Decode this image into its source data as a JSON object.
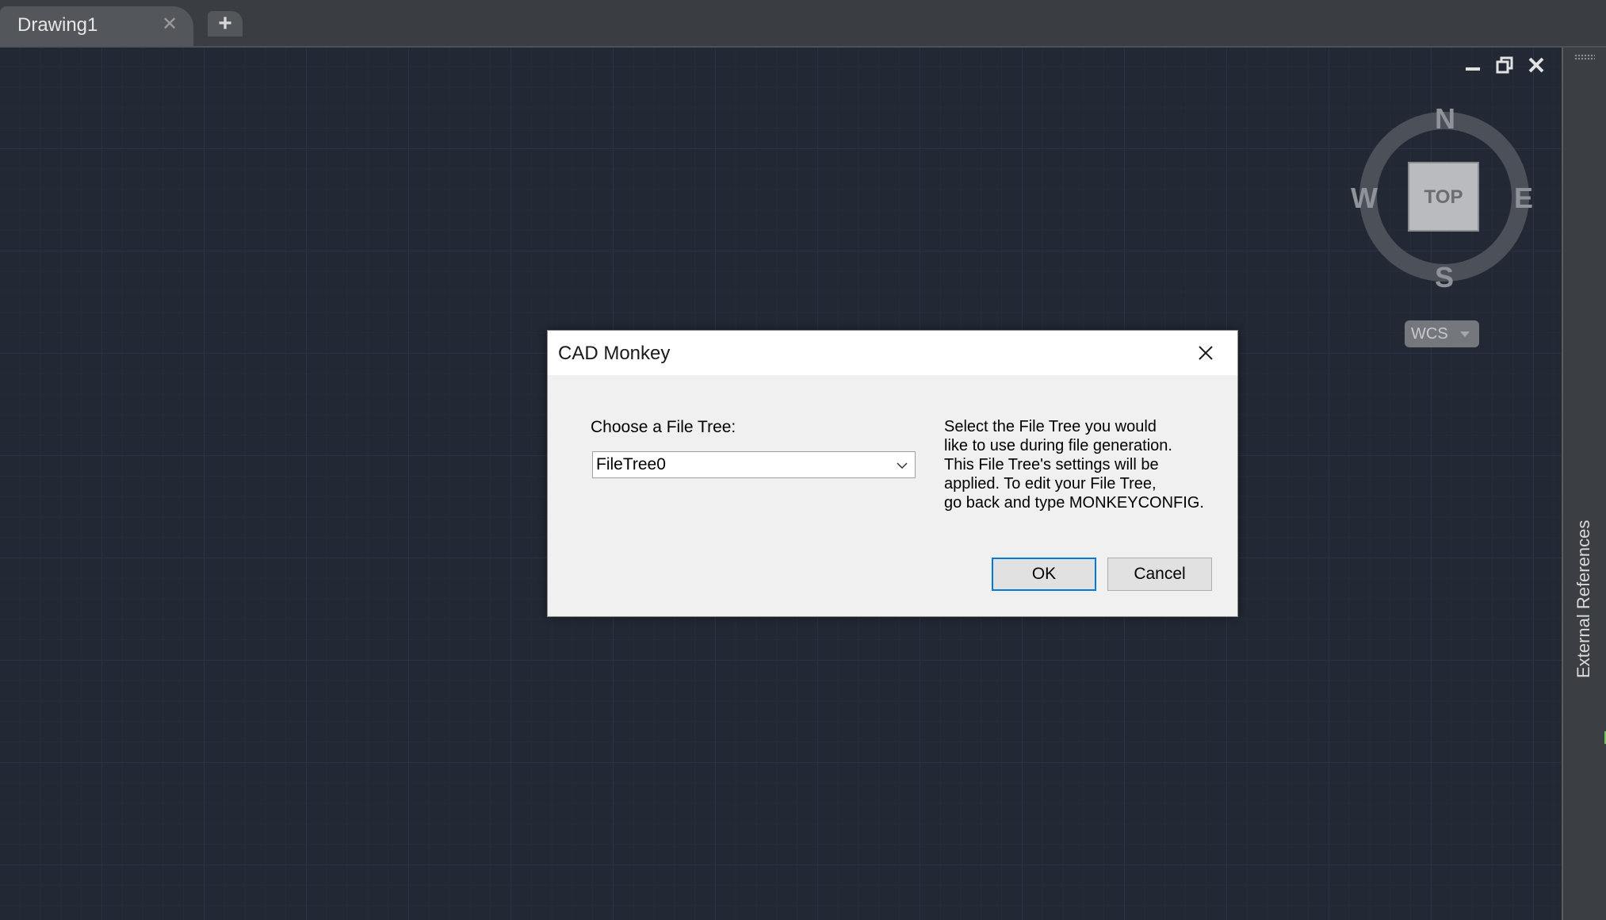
{
  "tabs": {
    "documents": [
      {
        "label": "Drawing1",
        "close_glyph": "✕"
      }
    ],
    "new_tab_glyph": "+"
  },
  "viewport": {
    "controls": [
      {
        "name": "minimize-icon"
      },
      {
        "name": "restore-icon"
      },
      {
        "name": "close-icon"
      }
    ],
    "viewcube": {
      "north": "N",
      "south": "S",
      "east": "E",
      "west": "W",
      "face": "TOP"
    },
    "ucs_menu": {
      "label": "WCS"
    }
  },
  "side_palette": {
    "label": "External References"
  },
  "dialog": {
    "title": "CAD Monkey",
    "choose_label": "Choose a File Tree:",
    "selected_tree": "FileTree0",
    "help_text": "Select the File Tree you would\nlike to use during file generation.\nThis File Tree's settings will be\napplied. To edit your File Tree,\ngo back and type MONKEYCONFIG.",
    "ok_label": "OK",
    "cancel_label": "Cancel"
  },
  "colors": {
    "canvas": "#222834",
    "dialog_accent": "#0078d7",
    "palette_indicator": "#6fc35a"
  }
}
